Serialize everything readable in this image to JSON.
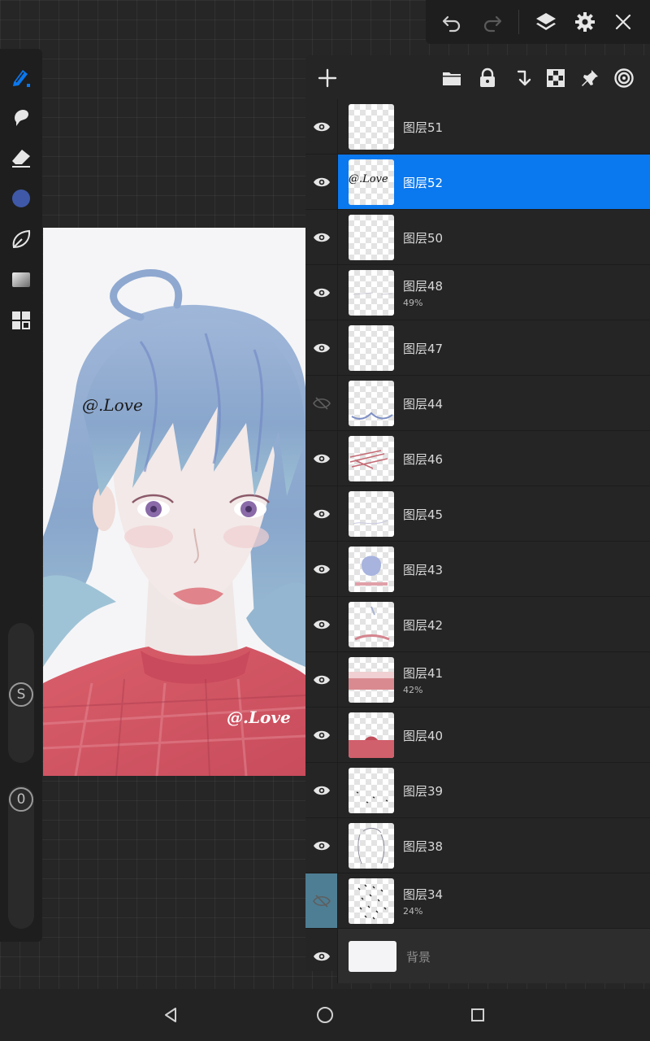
{
  "toolbar": {
    "icons": [
      "undo-icon",
      "redo-icon",
      "layers-icon",
      "gear-icon",
      "close-icon"
    ]
  },
  "tools": {
    "icons": [
      "pen-icon",
      "smudge-icon",
      "eraser-icon",
      "color-swatch",
      "shape-icon",
      "gradient-icon",
      "grid-icon"
    ],
    "active_color": "#3f59a8",
    "accent": "#0a78ee",
    "size_slider_label": "S",
    "opacity_slider_label": "0"
  },
  "canvas": {
    "watermark_1": "@.Love",
    "watermark_2": "@.Love"
  },
  "layers_toolbar": {
    "icons": [
      "add-icon",
      "folder-icon",
      "lock-icon",
      "merge-down-icon",
      "checker-icon",
      "pin-icon",
      "target-icon"
    ]
  },
  "layers": [
    {
      "name": "图层51",
      "opacity": "",
      "visible": true
    },
    {
      "name": "图层52",
      "opacity": "",
      "visible": true,
      "selected": true,
      "thumb_text": "@.Love"
    },
    {
      "name": "图层50",
      "opacity": "",
      "visible": true
    },
    {
      "name": "图层48",
      "opacity": "49%",
      "visible": true
    },
    {
      "name": "图层47",
      "opacity": "",
      "visible": true
    },
    {
      "name": "图层44",
      "opacity": "",
      "visible": false
    },
    {
      "name": "图层46",
      "opacity": "",
      "visible": true
    },
    {
      "name": "图层45",
      "opacity": "",
      "visible": true
    },
    {
      "name": "图层43",
      "opacity": "",
      "visible": true
    },
    {
      "name": "图层42",
      "opacity": "",
      "visible": true
    },
    {
      "name": "图层41",
      "opacity": "42%",
      "visible": true
    },
    {
      "name": "图层40",
      "opacity": "",
      "visible": true
    },
    {
      "name": "图层39",
      "opacity": "",
      "visible": true
    },
    {
      "name": "图层38",
      "opacity": "",
      "visible": true
    },
    {
      "name": "图层34",
      "opacity": "24%",
      "visible": false
    }
  ],
  "background_layer": {
    "name": "背景",
    "visible": true
  },
  "nav": {
    "icons": [
      "back-icon",
      "home-icon",
      "recents-icon"
    ]
  }
}
